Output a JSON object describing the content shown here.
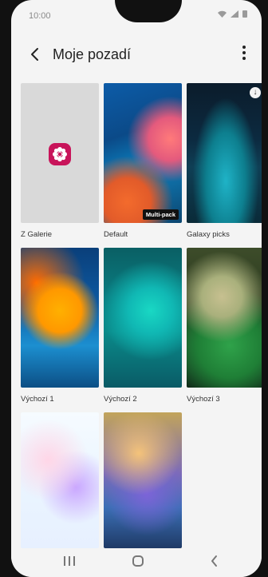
{
  "status": {
    "time": "10:00",
    "icons": [
      "wifi-icon",
      "signal-icon",
      "battery-icon"
    ]
  },
  "header": {
    "title": "Moje pozadí",
    "back_icon": "back-arrow-icon",
    "more_icon": "more-vertical-icon"
  },
  "wallpapers": [
    {
      "label": "Z Galerie",
      "type": "gallery",
      "icon": "flower-icon"
    },
    {
      "label": "Default",
      "badge": "Multi-pack"
    },
    {
      "label": "Galaxy picks",
      "icon": "download-icon"
    },
    {
      "label": "Výchozí 1"
    },
    {
      "label": "Výchozí 2"
    },
    {
      "label": "Výchozí 3"
    },
    {
      "label": ""
    },
    {
      "label": ""
    }
  ],
  "nav": {
    "recent_icon": "recent-apps-icon",
    "home_icon": "home-icon",
    "back_icon": "back-icon"
  },
  "colors": {
    "accent": "#c8145a",
    "background": "#f4f4f4",
    "text": "#222222"
  }
}
